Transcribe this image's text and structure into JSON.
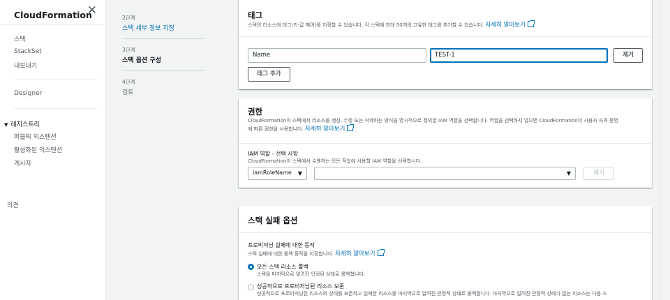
{
  "nav": {
    "title": "CloudFormation",
    "items": [
      "스택",
      "StackSet",
      "내보내기"
    ],
    "designer": "Designer",
    "registry_heading": "레지스트리",
    "registry_items": [
      "퍼블릭 익스텐션",
      "활성화된 익스텐션",
      "게시자"
    ],
    "feedback": "의견"
  },
  "steps": [
    {
      "num": "2단계",
      "label": "스택 세부 정보 지정"
    },
    {
      "num": "3단계",
      "label": "스택 옵션 구성"
    },
    {
      "num": "4단계",
      "label": "검토"
    }
  ],
  "tags": {
    "title": "태그",
    "desc": "스택의 리소스에 태그(키-값 페어)를 지정할 수 있습니다. 각 스택에 최대 50개의 고유한 태그를 추가할 수 있습니다.",
    "learn_more": "자세히 알아보기",
    "key_value": "Name",
    "value_value": "TEST-1",
    "remove_label": "제거",
    "add_label": "태그 추가"
  },
  "permissions": {
    "title": "권한",
    "desc_line1": "CloudFormation이 스택에서 리소스를 생성, 수정 또는 삭제하는 방식을 명시적으로 정의할 IAM 역할을 선택합니다. 역할을 선택하지 않으면 CloudFormation이 사용자 자격 증명",
    "desc_line2": "에 따른 권한을 사용합니다.",
    "learn_more": "자세히 알아보기",
    "iam_label": "IAM 역할 - 선택 사항",
    "iam_desc": "CloudFormation이 스택에서 수행하는 모든 작업에 사용할 IAM 역할을 선택합니다.",
    "iam_type": "iamRoleName",
    "remove_label": "제거"
  },
  "failure": {
    "title": "스택 실패 옵션",
    "behavior_label": "프로비저닝 실패에 대한 동작",
    "behavior_desc": "스택 실패에 대한 롤백 동작을 지정합니다.",
    "learn_more": "자세히 알아보기",
    "option1_label": "모든 스택 리소스 롤백",
    "option1_desc": "스택을 마지막으로 알려진 안정된 상태로 롤백합니다.",
    "option2_label": "성공적으로 프로비저닝된 리소스 보존",
    "option2_desc": "성공적으로 프로비저닝된 리소스의 상태를 보존하고 실패한 리소스를 마지막으로 알려진 안정적 상태로 롤백합니다. 마지막으로 알려진 안정적 상태가 없는 리소스는 다음 스"
  }
}
